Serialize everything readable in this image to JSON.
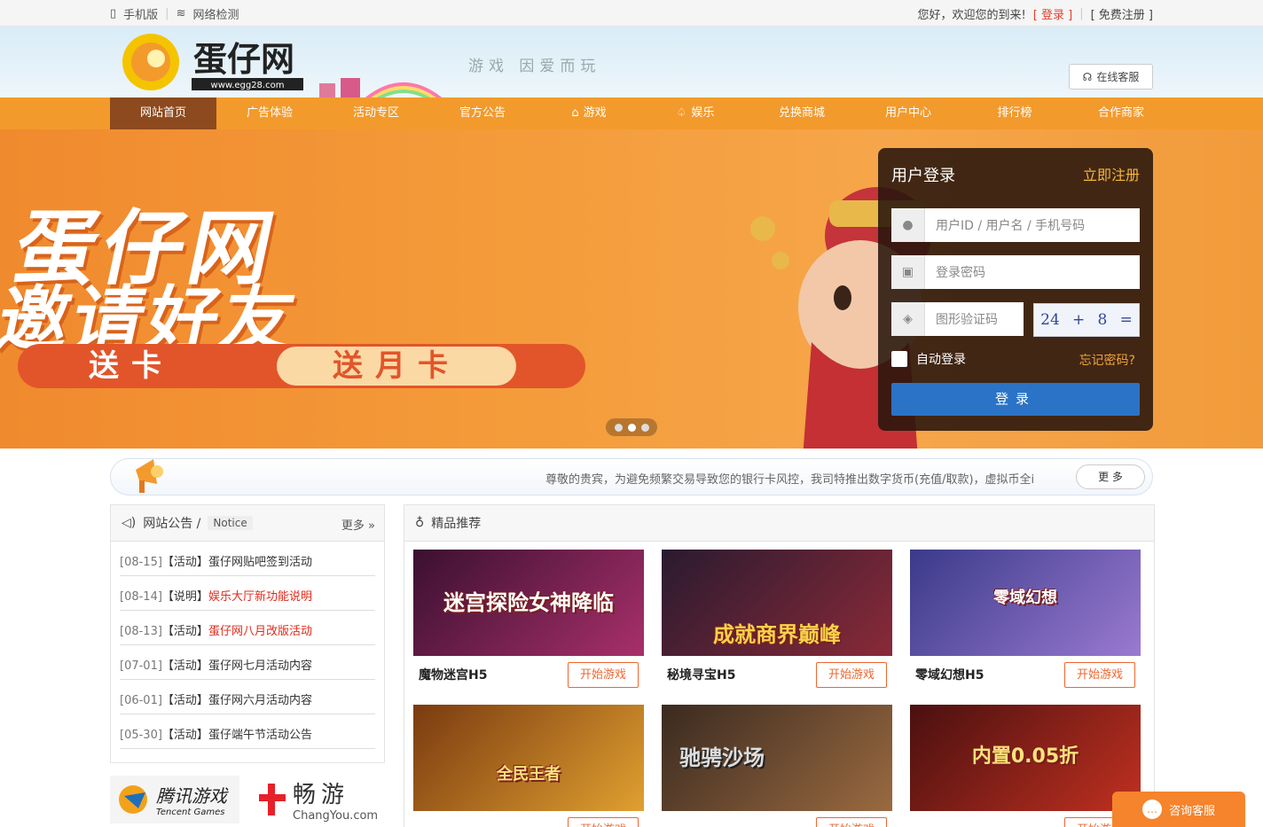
{
  "topbar": {
    "mobile": "手机版",
    "network": "网络检测",
    "welcome": "您好，欢迎您的到来!",
    "login": "[ 登录 ]",
    "sep": "|",
    "register": "[ 免费注册 ]"
  },
  "header": {
    "logo_text": "蛋仔网",
    "logo_url": "www.egg28.com",
    "slogan": "游戏 因爱而玩",
    "customer_service": "在线客服"
  },
  "nav": {
    "items": [
      {
        "label": "网站首页"
      },
      {
        "label": "广告体验"
      },
      {
        "label": "活动专区"
      },
      {
        "label": "官方公告"
      },
      {
        "label": "游戏"
      },
      {
        "label": "娱乐"
      },
      {
        "label": "兑换商城"
      },
      {
        "label": "用户中心"
      },
      {
        "label": "排行榜"
      },
      {
        "label": "合作商家"
      }
    ]
  },
  "banner": {
    "line1": "蛋仔网",
    "line2": "邀请好友",
    "pill1": "送卡",
    "pill2": "送月卡"
  },
  "login": {
    "title": "用户登录",
    "register_link": "立即注册",
    "username_placeholder": "用户ID / 用户名 / 手机号码",
    "password_placeholder": "登录密码",
    "captcha_placeholder": "图形验证码",
    "captcha_a": "24",
    "captcha_op": "+",
    "captcha_b": "8",
    "captcha_eq": "=",
    "remember": "自动登录",
    "forgot": "忘记密码?",
    "submit": "登录"
  },
  "notice_bar": {
    "text": "尊敬的贵宾，为避免频繁交易导致您的银行卡风控，我司特推出数字货币(充值/取款)，虚拟币全i",
    "more": "更 多"
  },
  "announcements": {
    "title": "网站公告 /",
    "title_en": "Notice",
    "more": "更多 »",
    "items": [
      {
        "date": "[08-15]",
        "tag": "【活动】",
        "text": "蛋仔网贴吧签到活动",
        "highlight": false
      },
      {
        "date": "[08-14]",
        "tag": "【说明】",
        "text": "娱乐大厅新功能说明",
        "highlight": true
      },
      {
        "date": "[08-13]",
        "tag": "【活动】",
        "text": "蛋仔网八月改版活动",
        "highlight": true
      },
      {
        "date": "[07-01]",
        "tag": "【活动】",
        "text": "蛋仔网七月活动内容",
        "highlight": false
      },
      {
        "date": "[06-01]",
        "tag": "【活动】",
        "text": "蛋仔网六月活动内容",
        "highlight": false
      },
      {
        "date": "[05-30]",
        "tag": "【活动】",
        "text": "蛋仔端午节活动公告",
        "highlight": false
      }
    ]
  },
  "partners": {
    "tencent": "腾讯游戏",
    "tencent_en": "Tencent Games",
    "changyou": "畅游",
    "changyou_en": "ChangYou.com"
  },
  "recommend": {
    "title": "精品推荐",
    "play_label": "开始游戏",
    "games": [
      {
        "name": "魔物迷宫H5",
        "banner": "迷宫探险女神降临",
        "color1": "#3a1030",
        "color2": "#a8306a"
      },
      {
        "name": "秘境寻宝H5",
        "banner": "成就商界巅峰",
        "color1": "#2a1a30",
        "color2": "#8a2a38"
      },
      {
        "name": "零域幻想H5",
        "banner": "零域幻想",
        "color1": "#3a3a8a",
        "color2": "#9a7ad0"
      },
      {
        "name": "",
        "banner": "全民王者",
        "color1": "#7a3a10",
        "color2": "#e0a030"
      },
      {
        "name": "",
        "banner": "驰骋沙场",
        "color1": "#3a2a20",
        "color2": "#9a6a40"
      },
      {
        "name": "",
        "banner": "内置0.05折",
        "color1": "#4a1010",
        "color2": "#c03020"
      }
    ]
  },
  "float_cs": {
    "label": "咨询客服"
  }
}
